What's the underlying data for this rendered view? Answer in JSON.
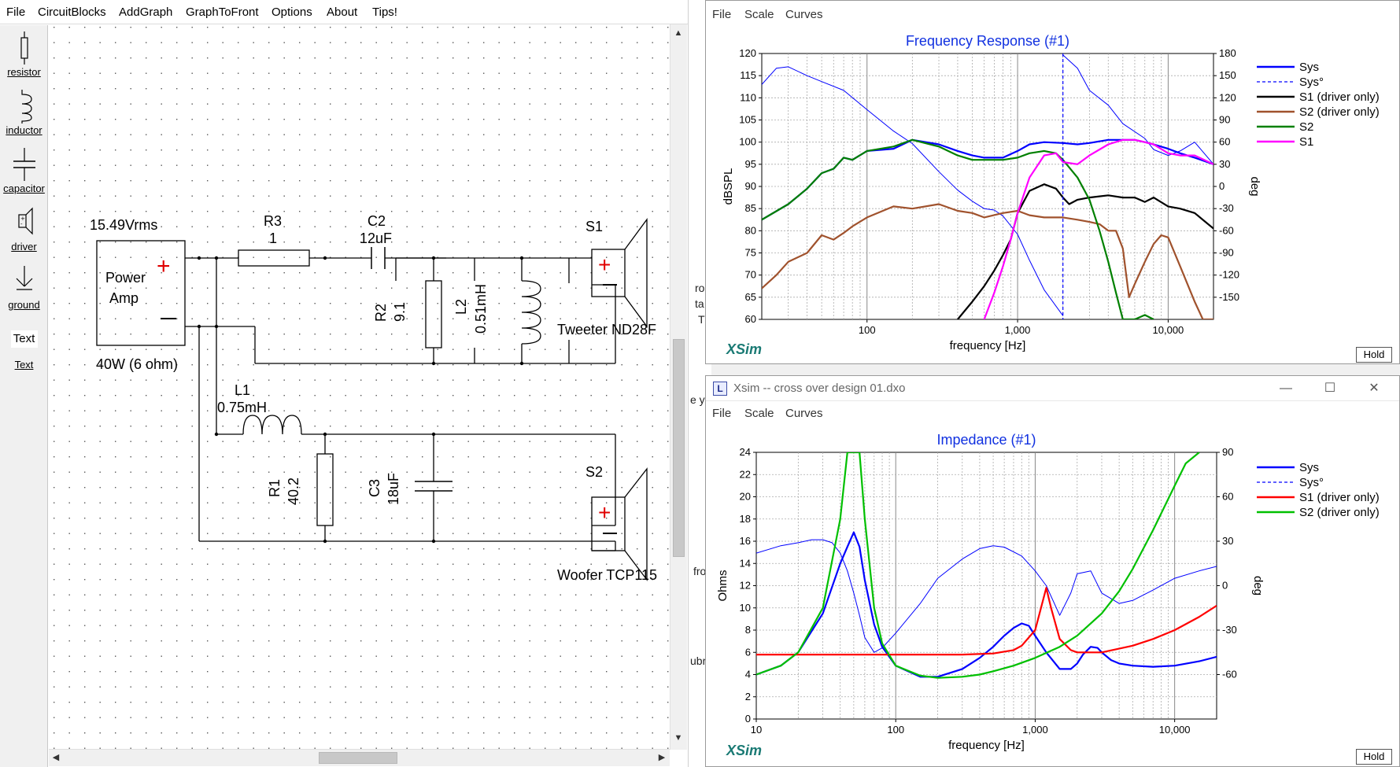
{
  "menubar": {
    "items": [
      "File",
      "CircuitBlocks",
      "AddGraph",
      "GraphToFront",
      "Options",
      "About",
      "Tips!"
    ]
  },
  "toolbox": {
    "items": [
      {
        "label": "resistor",
        "icon": "resistor-icon"
      },
      {
        "label": "inductor",
        "icon": "inductor-icon"
      },
      {
        "label": "capacitor",
        "icon": "capacitor-icon"
      },
      {
        "label": "driver",
        "icon": "driver-icon"
      },
      {
        "label": "ground",
        "icon": "ground-icon"
      },
      {
        "label": "Text",
        "button": "Text"
      }
    ]
  },
  "schematic": {
    "source_voltage": "15.49Vrms",
    "source_name_1": "Power",
    "source_name_2": "Amp",
    "source_rating": "40W (6 ohm)",
    "plus": "+",
    "minus": "−",
    "r3": {
      "name": "R3",
      "value": "1"
    },
    "c2": {
      "name": "C2",
      "value": "12uF"
    },
    "r2": {
      "name": "R2",
      "value": "9.1"
    },
    "l2": {
      "name": "L2",
      "value": "0.51mH"
    },
    "l1": {
      "name": "L1",
      "value": "0.75mH"
    },
    "r1": {
      "name": "R1",
      "value": "40.2"
    },
    "c3": {
      "name": "C3",
      "value": "18uF"
    },
    "s1": {
      "name": "S1",
      "label": "Tweeter ND28F"
    },
    "s2": {
      "name": "S2",
      "label": "Woofer TCP115"
    }
  },
  "background_window": {
    "fragments": [
      "ro",
      "ta",
      "T",
      "e y",
      "fro",
      "ubr"
    ]
  },
  "graph_window_1": {
    "menu": [
      "File",
      "Scale",
      "Curves"
    ],
    "hold_label": "Hold",
    "logo": "XSim"
  },
  "graph_window_2": {
    "title": "Xsim -- cross over design 01.dxo",
    "menu": [
      "File",
      "Scale",
      "Curves"
    ],
    "hold_label": "Hold",
    "logo": "XSim",
    "controls": {
      "minimize": "—",
      "maximize": "☐",
      "close": "✕"
    }
  },
  "chart_data": [
    {
      "type": "line",
      "title": "Frequency Response (#1)",
      "xlabel": "frequency [Hz]",
      "ylabel": "dBSPL",
      "y2label": "deg",
      "xscale": "log",
      "xlim": [
        20,
        20000
      ],
      "ylim": [
        60,
        120
      ],
      "y2lim": [
        -180,
        180
      ],
      "x_ticks": [
        "100",
        "1,000",
        "10,000"
      ],
      "y_ticks": [
        "60",
        "65",
        "70",
        "75",
        "80",
        "85",
        "90",
        "95",
        "100",
        "105",
        "110",
        "115",
        "120"
      ],
      "y2_ticks": [
        "-150",
        "-120",
        "-90",
        "-60",
        "-30",
        "0",
        "30",
        "60",
        "90",
        "120",
        "150",
        "180"
      ],
      "grid": true,
      "legend_position": "right",
      "series": [
        {
          "name": "Sys",
          "color": "#0000ff",
          "axis": "left",
          "x": [
            20,
            30,
            40,
            50,
            60,
            70,
            80,
            100,
            150,
            200,
            300,
            400,
            500,
            600,
            800,
            1000,
            1200,
            1500,
            2000,
            2500,
            3000,
            4000,
            5000,
            6000,
            7000,
            8000,
            10000,
            12000,
            15000,
            20000
          ],
          "values": [
            82.5,
            86,
            89.5,
            93,
            94,
            96.5,
            96,
            98,
            98.5,
            100.5,
            99.5,
            98,
            97,
            96.5,
            96.5,
            98,
            99.5,
            100,
            99.8,
            99.5,
            99.8,
            100.5,
            100.5,
            100.5,
            100,
            99.5,
            98.5,
            97.5,
            96.5,
            95
          ]
        },
        {
          "name": "Sys°",
          "color": "#0000ff",
          "axis": "right",
          "x": [
            20,
            25,
            30,
            40,
            50,
            70,
            100,
            150,
            200,
            300,
            400,
            500,
            600,
            700,
            800,
            1000,
            1200,
            1500,
            2000,
            2000,
            2500,
            3000,
            4000,
            5000,
            7000,
            8000,
            10000,
            12000,
            15000,
            20000
          ],
          "values": [
            138,
            160,
            162,
            150,
            142,
            130,
            104,
            75,
            58,
            20,
            -5,
            -20,
            -30,
            -32,
            -40,
            -65,
            -100,
            -140,
            -175,
            178,
            160,
            130,
            110,
            85,
            65,
            50,
            42,
            48,
            60,
            30
          ]
        },
        {
          "name": "S1 (driver only)",
          "color": "#000000",
          "axis": "left",
          "x": [
            400,
            500,
            600,
            700,
            800,
            900,
            1000,
            1200,
            1500,
            1800,
            2000,
            2200,
            2500,
            3000,
            4000,
            5000,
            6000,
            7000,
            8000,
            10000,
            12000,
            15000,
            20000
          ],
          "values": [
            60,
            64,
            67.5,
            71,
            74.5,
            78,
            84,
            89,
            90.5,
            89.5,
            87.5,
            86,
            87,
            87.5,
            88,
            87.5,
            87.5,
            86.5,
            87.5,
            85.5,
            85,
            84,
            80.5
          ]
        },
        {
          "name": "S2 (driver only)",
          "color": "#a0522d",
          "axis": "left",
          "x": [
            20,
            25,
            30,
            40,
            50,
            60,
            70,
            80,
            100,
            150,
            200,
            300,
            400,
            500,
            600,
            800,
            1000,
            1200,
            1500,
            2000,
            2500,
            3000,
            3500,
            4000,
            4500,
            5000,
            5500,
            6000,
            7000,
            8000,
            9000,
            10000,
            12000,
            15000,
            17000,
            20000
          ],
          "values": [
            67,
            70,
            73,
            75,
            79,
            78,
            79.5,
            81,
            83,
            85.5,
            85,
            86,
            84.5,
            84,
            83,
            84,
            84.5,
            83.5,
            83,
            83,
            82.5,
            82,
            81.5,
            80,
            80,
            76,
            65,
            68,
            73,
            77,
            79,
            78.5,
            72,
            64,
            60,
            60
          ]
        },
        {
          "name": "S2",
          "color": "#008000",
          "axis": "left",
          "x": [
            20,
            30,
            40,
            50,
            60,
            70,
            80,
            100,
            150,
            200,
            300,
            400,
            500,
            600,
            800,
            1000,
            1200,
            1500,
            1800,
            2000,
            2500,
            3000,
            3500,
            4000,
            4500,
            5000,
            5500,
            6000,
            7000,
            8000
          ],
          "values": [
            82.5,
            86,
            89.5,
            93,
            94,
            96.5,
            96,
            98,
            99,
            100.5,
            99,
            97,
            96,
            96,
            96,
            96.5,
            97.5,
            98,
            97.5,
            96,
            92,
            87,
            80,
            73,
            66,
            60,
            60,
            60,
            61,
            60
          ]
        },
        {
          "name": "S1",
          "color": "#ff00ff",
          "axis": "left",
          "x": [
            600,
            700,
            800,
            900,
            1000,
            1200,
            1500,
            1800,
            2000,
            2500,
            3000,
            4000,
            5000,
            6000,
            7000,
            8000,
            10000,
            12000,
            15000,
            20000
          ],
          "values": [
            60,
            66,
            72,
            78,
            84,
            92,
            97,
            97.5,
            95.5,
            95,
            97,
            99.5,
            100.5,
            100.5,
            100,
            99.5,
            97.5,
            97,
            97,
            95
          ]
        }
      ]
    },
    {
      "type": "line",
      "title": "Impedance (#1)",
      "xlabel": "frequency [Hz]",
      "ylabel": "Ohms",
      "y2label": "deg",
      "xscale": "log",
      "xlim": [
        10,
        20000
      ],
      "ylim": [
        0,
        24
      ],
      "y2lim": [
        -90,
        90
      ],
      "x_ticks": [
        "10",
        "100",
        "1,000",
        "10,000"
      ],
      "y_ticks": [
        "0",
        "2",
        "4",
        "6",
        "8",
        "10",
        "12",
        "14",
        "16",
        "18",
        "20",
        "22",
        "24"
      ],
      "y2_ticks": [
        "-60",
        "-30",
        "0",
        "30",
        "60",
        "90"
      ],
      "grid": true,
      "legend_position": "right",
      "series": [
        {
          "name": "Sys",
          "color": "#0000ff",
          "axis": "left",
          "x": [
            10,
            15,
            20,
            30,
            40,
            45,
            50,
            55,
            60,
            70,
            80,
            100,
            150,
            200,
            300,
            400,
            500,
            600,
            700,
            800,
            900,
            1000,
            1200,
            1500,
            1800,
            2000,
            2200,
            2500,
            2800,
            3000,
            3500,
            4000,
            5000,
            7000,
            10000,
            15000,
            20000
          ],
          "values": [
            4,
            4.8,
            6,
            9.5,
            14,
            15.5,
            16.8,
            15.5,
            12.5,
            8.5,
            6.5,
            4.8,
            3.8,
            3.8,
            4.5,
            5.5,
            6.5,
            7.5,
            8.2,
            8.6,
            8.4,
            7.5,
            6,
            4.5,
            4.5,
            5,
            5.8,
            6.5,
            6.4,
            6,
            5.3,
            5,
            4.8,
            4.7,
            4.8,
            5.2,
            5.6
          ]
        },
        {
          "name": "Sys°",
          "color": "#0000ff",
          "axis": "right",
          "x": [
            10,
            15,
            20,
            25,
            30,
            35,
            40,
            45,
            50,
            55,
            60,
            70,
            80,
            100,
            150,
            200,
            300,
            400,
            500,
            600,
            800,
            1000,
            1200,
            1500,
            1800,
            2000,
            2500,
            3000,
            4000,
            5000,
            7000,
            10000,
            15000,
            20000
          ],
          "values": [
            22,
            27,
            29,
            31,
            31,
            29,
            22,
            10,
            -5,
            -20,
            -35,
            -45,
            -42,
            -32,
            -12,
            5,
            18,
            25,
            27,
            26,
            20,
            10,
            0,
            -20,
            -5,
            8,
            10,
            -5,
            -12,
            -10,
            -3,
            5,
            10,
            13
          ]
        },
        {
          "name": "S1 (driver only)",
          "color": "#ff0000",
          "axis": "left",
          "x": [
            10,
            100,
            200,
            300,
            500,
            700,
            800,
            1000,
            1100,
            1200,
            1300,
            1500,
            1800,
            2000,
            3000,
            5000,
            7000,
            10000,
            15000,
            20000
          ],
          "values": [
            5.8,
            5.8,
            5.8,
            5.8,
            5.9,
            6.2,
            6.6,
            8,
            10,
            11.8,
            10,
            7.2,
            6.2,
            6,
            6,
            6.6,
            7.2,
            8,
            9.2,
            10.2
          ]
        },
        {
          "name": "S2 (driver only)",
          "color": "#00c000",
          "axis": "left",
          "x": [
            10,
            15,
            20,
            30,
            40,
            45,
            50,
            55,
            60,
            70,
            80,
            100,
            150,
            200,
            300,
            400,
            500,
            700,
            1000,
            1500,
            2000,
            3000,
            4000,
            5000,
            7000,
            10000,
            12000,
            15000
          ],
          "values": [
            4,
            4.8,
            6,
            10,
            18,
            24,
            24,
            24,
            18,
            10,
            6.8,
            4.8,
            3.9,
            3.7,
            3.8,
            4,
            4.3,
            4.8,
            5.5,
            6.5,
            7.5,
            9.5,
            11.5,
            13.5,
            17,
            21,
            23,
            24
          ]
        }
      ]
    }
  ]
}
